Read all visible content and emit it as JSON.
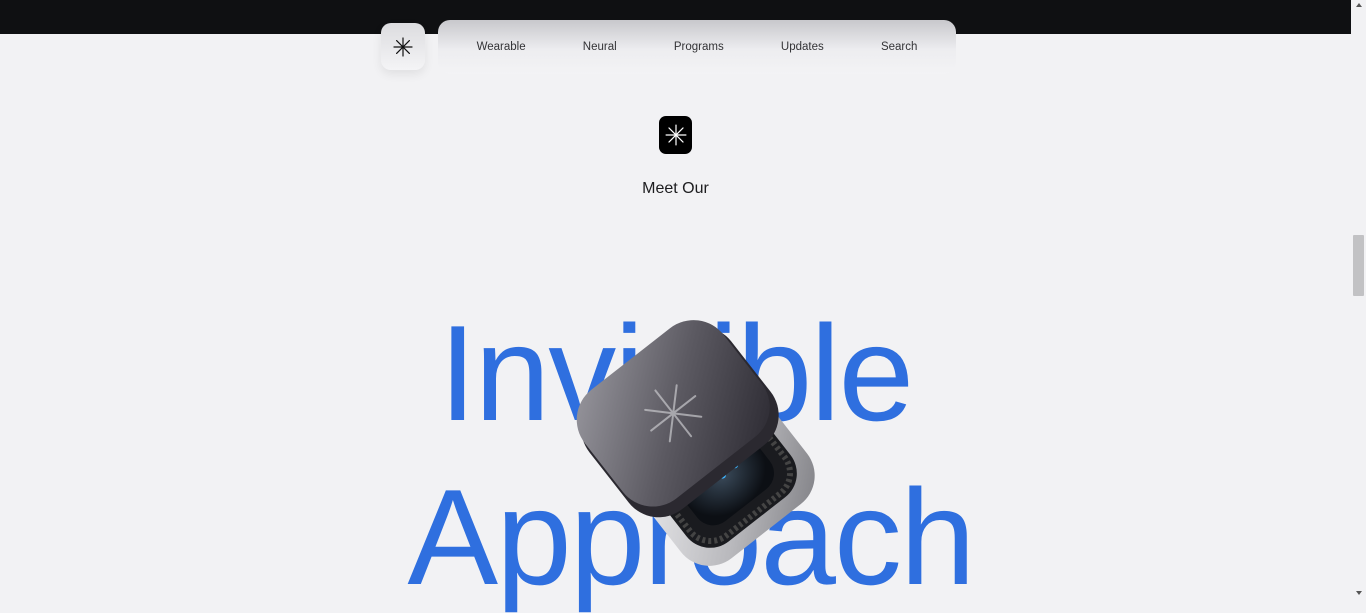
{
  "nav": {
    "logo_icon": "sparkle-asterisk-icon",
    "items": [
      "Wearable",
      "Neural",
      "Programs",
      "Updates",
      "Search"
    ]
  },
  "hero": {
    "badge_icon": "sparkle-asterisk-icon",
    "subtitle": "Meet Our",
    "line1": "Invisible",
    "line2": "Approach",
    "accent_color": "#2f6fdf"
  },
  "device_image": "wearable-device-image"
}
